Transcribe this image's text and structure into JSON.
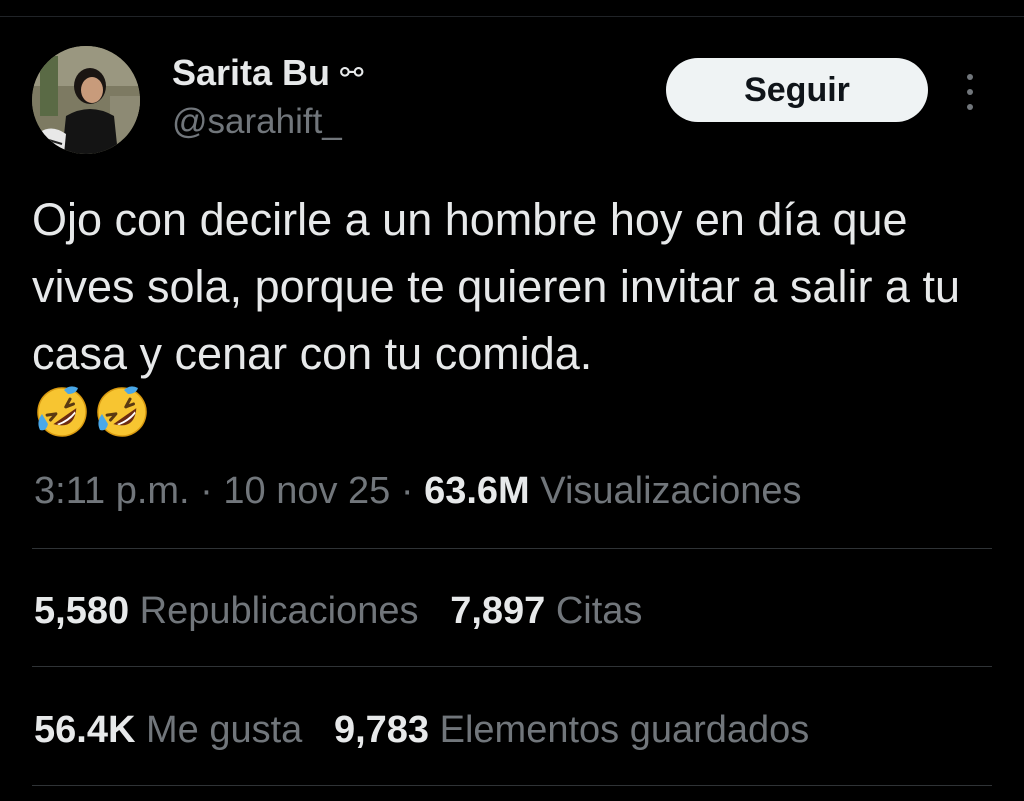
{
  "author": {
    "display_name": "Sarita Bu",
    "name_glyph": "⚯",
    "handle": "@sarahift_"
  },
  "follow_button": {
    "label": "Seguir"
  },
  "tweet": {
    "text": "Ojo con decirle a un hombre hoy en día que vives sola, porque te quieren invitar a salir a tu casa y cenar con tu comida.",
    "emoji_icons": [
      "rolling-on-floor-laughing-icon",
      "rolling-on-floor-laughing-icon"
    ]
  },
  "meta": {
    "time": "3:11 p.m.",
    "separator": "·",
    "date": "10 nov 25",
    "views_count": "63.6M",
    "views_label": "Visualizaciones"
  },
  "stats": {
    "reposts_count": "5,580",
    "reposts_label": "Republicaciones",
    "quotes_count": "7,897",
    "quotes_label": "Citas",
    "likes_count": "56.4K",
    "likes_label": "Me gusta",
    "bookmarks_count": "9,783",
    "bookmarks_label": "Elementos guardados"
  },
  "colors": {
    "background": "#000000",
    "primary_text": "#e7e9ea",
    "secondary_text": "#71767b",
    "divider": "#2f3336",
    "button_bg": "#eff3f4"
  }
}
